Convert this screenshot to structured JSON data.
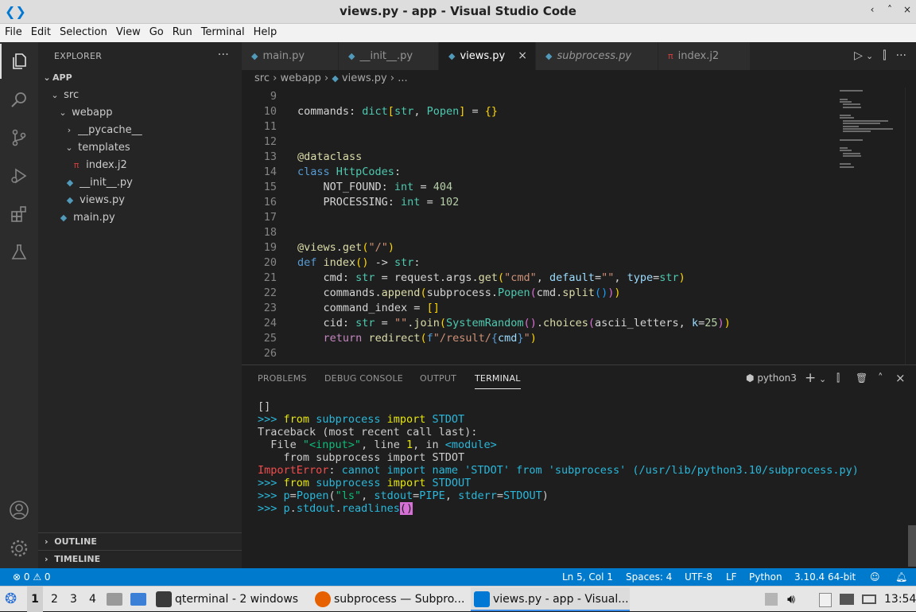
{
  "window": {
    "title": "views.py - app - Visual Studio Code",
    "controls": [
      "‹",
      "˄",
      "×"
    ]
  },
  "menu": [
    "File",
    "Edit",
    "Selection",
    "View",
    "Go",
    "Run",
    "Terminal",
    "Help"
  ],
  "activity_icons": [
    "files-icon",
    "search-icon",
    "source-control-icon",
    "run-debug-icon",
    "extensions-icon",
    "testing-icon",
    "account-icon",
    "settings-icon"
  ],
  "sidebar": {
    "title": "EXPLORER",
    "more": "···",
    "root": "APP",
    "tree": [
      {
        "label": "src",
        "chev": "⌄",
        "icon": ""
      },
      {
        "label": "webapp",
        "chev": "⌄",
        "icon": ""
      },
      {
        "label": "__pycache__",
        "chev": "›",
        "icon": ""
      },
      {
        "label": "templates",
        "chev": "⌄",
        "icon": ""
      },
      {
        "label": "index.j2",
        "chev": "",
        "icon": "π"
      },
      {
        "label": "__init__.py",
        "chev": "",
        "icon": "◆"
      },
      {
        "label": "views.py",
        "chev": "",
        "icon": "◆"
      },
      {
        "label": "main.py",
        "chev": "",
        "icon": "◆"
      }
    ],
    "outline": "OUTLINE",
    "timeline": "TIMELINE"
  },
  "tabs": [
    {
      "label": "main.py",
      "icon": "◆"
    },
    {
      "label": "__init__.py",
      "icon": "◆"
    },
    {
      "label": "views.py",
      "icon": "◆",
      "close": "×"
    },
    {
      "label": "subprocess.py",
      "icon": "◆"
    },
    {
      "label": "index.j2",
      "icon": "π"
    }
  ],
  "tab_actions": [
    "▷",
    "⌄",
    "⫿",
    "···"
  ],
  "breadcrumb": {
    "parts": [
      "src",
      "webapp",
      "views.py",
      "..."
    ],
    "sep": "›"
  },
  "editor": {
    "line_numbers": [
      "9",
      "10",
      "11",
      "12",
      "13",
      "14",
      "15",
      "16",
      "17",
      "18",
      "19",
      "20",
      "21",
      "22",
      "23",
      "24",
      "25",
      "26"
    ],
    "lines": [
      "",
      "commands: dict[str, Popen] = {}",
      "",
      "",
      "@dataclass",
      "class HttpCodes:",
      "    NOT_FOUND: int = 404",
      "    PROCESSING: int = 102",
      "",
      "",
      "@views.get(\"/\")",
      "def index() -> str:",
      "    cmd: str = request.args.get(\"cmd\", default=\"\", type=str)",
      "    commands.append(subprocess.Popen(cmd.split()))",
      "    command_index = []",
      "    cid: str = \"\".join(SystemRandom().choices(ascii_letters, k=25))",
      "    return redirect(f\"/result/{cmd}\")",
      ""
    ]
  },
  "panel": {
    "tabs": [
      "PROBLEMS",
      "DEBUG CONSOLE",
      "OUTPUT",
      "TERMINAL"
    ],
    "active_tab": "TERMINAL",
    "shell": "python3",
    "actions": [
      "+",
      "⌄",
      "⫿",
      "🗑",
      "˄",
      "×"
    ],
    "terminal": [
      "[]",
      ">>> from subprocess import STDOT",
      "Traceback (most recent call last):",
      "  File \"<input>\", line 1, in <module>",
      "    from subprocess import STDOT",
      "ImportError: cannot import name 'STDOT' from 'subprocess' (/usr/lib/python3.10/subprocess.py)",
      ">>> from subprocess import STDOUT",
      ">>> p=Popen(\"ls\", stdout=PIPE, stderr=STDOUT)",
      ">>> p.stdout.readlines()"
    ]
  },
  "statusbar": {
    "errors": "⊗ 0 ⚠ 0",
    "position": "Ln 5, Col 1",
    "spaces": "Spaces: 4",
    "encoding": "UTF-8",
    "eol": "LF",
    "language": "Python",
    "interpreter": "3.10.4 64-bit",
    "icons": [
      "feedback-icon",
      "bell-icon"
    ]
  },
  "taskbar": {
    "workspaces": [
      "1",
      "2",
      "3",
      "4"
    ],
    "tasks": [
      {
        "label": "qterminal - 2 windows",
        "color": "#3a3a3a"
      },
      {
        "label": "subprocess — Subpro...",
        "color": "#e66000"
      },
      {
        "label": "views.py - app - Visual...",
        "color": "#0078d4"
      }
    ],
    "clock": "13:54"
  },
  "colors": {
    "accent": "#007acc",
    "editor_bg": "#1e1e1e",
    "sidebar_bg": "#252526",
    "activity_bg": "#2c2c2c"
  }
}
